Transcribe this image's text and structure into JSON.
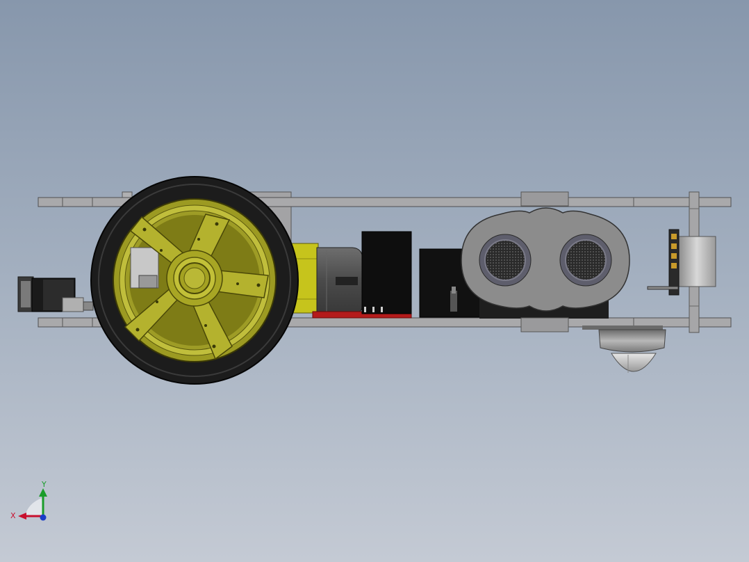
{
  "viewport": {
    "view": "side",
    "background_gradient": [
      "#8797ac",
      "#a4b0c0",
      "#c4cad4"
    ]
  },
  "model": {
    "parts": [
      "wheel",
      "gear-motor",
      "ultrasonic-sensor",
      "caster-ball",
      "battery-box",
      "driver-board",
      "switch",
      "mounting-bracket"
    ],
    "colors": {
      "plate": "#a8a8aa",
      "tire": "#1c1c1c",
      "rim": "#9c9a22",
      "motor": "#c4c21a",
      "board": "#101010",
      "pcb_red": "#b81c1c",
      "sensor_body": "#8e8e8e"
    }
  },
  "axis_triad": {
    "x_label": "X",
    "y_label": "Y",
    "x_color": "#c8102e",
    "y_color": "#1a9c2a",
    "z_color": "#1a3cc8"
  }
}
